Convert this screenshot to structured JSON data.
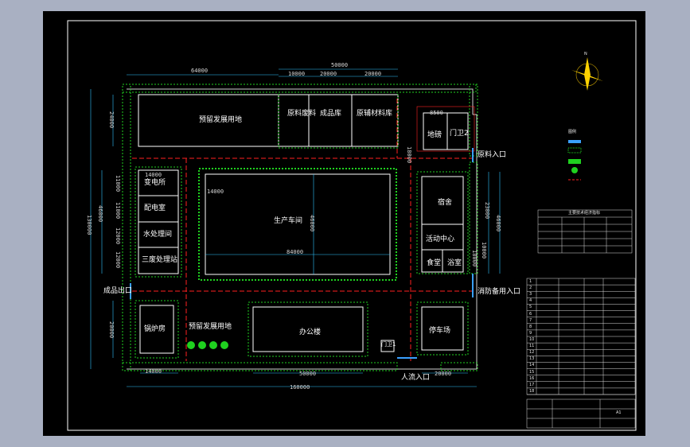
{
  "colors": {
    "background": "#000000",
    "frame": "#ffffff",
    "hedge": "#1fd11f",
    "road_center": "#ff2020",
    "dimension": "#2ec4ff",
    "entrance": "#3aa0ff",
    "wall": "#d0d0d0"
  },
  "buildings": {
    "reserve_top": "预留发展用地",
    "raw_waste": "原料废料",
    "finished_storage": "成品库",
    "packaging": "原辅材料库",
    "guard_room": "门卫2",
    "greening": "地磅",
    "power_room": "变电所",
    "distribution": "配电室",
    "water_pump": "水处理间",
    "three_waste": "三废处理站",
    "workshop": "生产车间",
    "dormitory": "宿舍",
    "activity": "活动中心",
    "canteen": "食堂",
    "bath": "浴室",
    "boiler": "锅炉房",
    "reserve_bottom": "预留发展用地",
    "office": "办公楼",
    "garage": "停车场",
    "guard_main": "门卫1"
  },
  "entrances": {
    "logistics": "原料入口",
    "product_out": "成品出口",
    "fire": "消防备用入口",
    "people": "人流入口"
  },
  "dimensions": {
    "top_left": "64000",
    "top_right": "50000",
    "top_a": "10000",
    "top_b": "20000",
    "top_c": "20000",
    "guard_w": "8500",
    "left_top": "24000",
    "left_mid": "46000",
    "left_total": "130000",
    "left_bottom": "20000",
    "left_a": "14000",
    "left_b": "11000",
    "left_c": "11000",
    "left_d": "12000",
    "left_e": "12000",
    "right_a": "18000",
    "right_b": "23000",
    "right_c": "46000",
    "right_d": "10000",
    "right_e": "18000",
    "workshop_w": "84000",
    "workshop_h": "46000",
    "workshop_side": "14000",
    "bottom_a": "14000",
    "bottom_b": "50000",
    "bottom_c": "20000",
    "bottom_total": "160000"
  },
  "north": {
    "label": "N"
  },
  "legend": {
    "title": "图例"
  },
  "econ_table": {
    "title": "主要技术经济指标"
  },
  "building_table": {
    "rows": [
      "1",
      "2",
      "3",
      "4",
      "5",
      "6",
      "7",
      "8",
      "9",
      "10",
      "11",
      "12",
      "13",
      "14",
      "15",
      "16",
      "17",
      "18"
    ]
  },
  "title_block": {
    "drawing_no": "A1"
  }
}
